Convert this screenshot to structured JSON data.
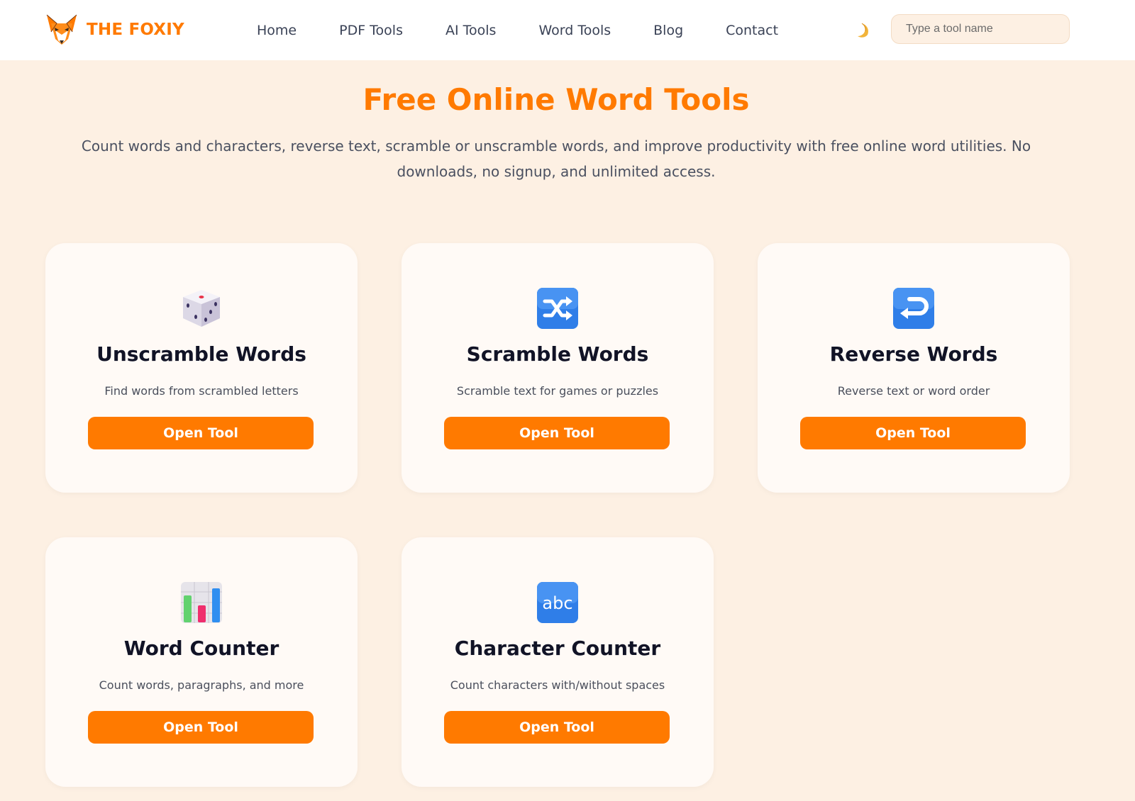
{
  "brand": {
    "name": "THE FOXIY",
    "accent": "#ff7a00"
  },
  "nav": {
    "items": [
      {
        "label": "Home"
      },
      {
        "label": "PDF Tools"
      },
      {
        "label": "AI Tools"
      },
      {
        "label": "Word Tools"
      },
      {
        "label": "Blog"
      },
      {
        "label": "Contact"
      }
    ]
  },
  "theme_toggle": {
    "icon": "moon-icon"
  },
  "search": {
    "placeholder": "Type a tool name",
    "value": ""
  },
  "hero": {
    "title": "Free Online Word Tools",
    "description": "Count words and characters, reverse text, scramble or unscramble words, and improve productivity with free online word utilities. No downloads, no signup, and unlimited access."
  },
  "cards": [
    {
      "icon": "dice-icon",
      "title": "Unscramble Words",
      "desc": "Find words from scrambled letters",
      "button": "Open Tool"
    },
    {
      "icon": "shuffle-icon",
      "title": "Scramble Words",
      "desc": "Scramble text for games or puzzles",
      "button": "Open Tool"
    },
    {
      "icon": "return-arrow-icon",
      "title": "Reverse Words",
      "desc": "Reverse text or word order",
      "button": "Open Tool"
    },
    {
      "icon": "bar-chart-icon",
      "title": "Word Counter",
      "desc": "Count words, paragraphs, and more",
      "button": "Open Tool"
    },
    {
      "icon": "abc-icon",
      "title": "Character Counter",
      "desc": "Count characters with/without spaces",
      "button": "Open Tool"
    }
  ]
}
